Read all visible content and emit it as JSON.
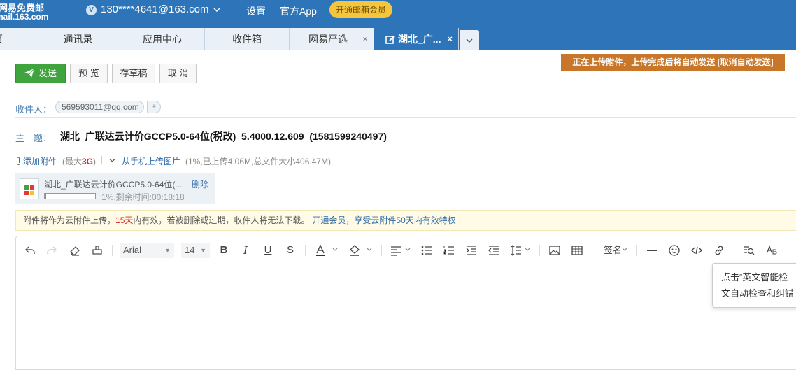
{
  "header": {
    "logo_line1": "网易免费邮",
    "logo_line2": "mail.163.com",
    "vip_badge": "V",
    "account": "130****4641@163.com",
    "links": [
      "设置",
      "官方App"
    ],
    "vip_button": "开通邮箱会员"
  },
  "tabs": [
    {
      "label": "页"
    },
    {
      "label": "通讯录"
    },
    {
      "label": "应用中心"
    },
    {
      "label": "收件箱"
    },
    {
      "label": "网易严选",
      "close": "×"
    },
    {
      "label": "湖北_广...",
      "close": "×"
    }
  ],
  "toolbar": {
    "send": "发送",
    "preview": "预 览",
    "draft": "存草稿",
    "cancel": "取 消"
  },
  "notice": {
    "text": "正在上传附件，上传完成后将自动发送 ",
    "cancel_link": "[取消自动发送]"
  },
  "recipient": {
    "label": "收件人：",
    "chip": "569593011@qq.com",
    "add": "+"
  },
  "subject": {
    "label": "主　题：",
    "value": "湖北_广联达云计价GCCP5.0-64位(税改)_5.4000.12.609_(1581599240497)"
  },
  "attachments": {
    "add_label": "添加附件",
    "max_prefix": "(最大",
    "max_value": "3G",
    "max_suffix": ")",
    "mobile_upload": "从手机上传图片",
    "summary": "(1%,已上传4.06M,总文件大小406.47M)",
    "file": {
      "name": "湖北_广联达云计价GCCP5.0-64位(...",
      "delete": "删除",
      "progress": 0.01,
      "remain": "1%,剩余时间:00:18:18"
    }
  },
  "cloud_tip": {
    "text1": "附件将作为云附件上传，",
    "days": "15天",
    "text2": "内有效，若被删除或过期，收件人将无法下载。",
    "link": "开通会员，享受云附件50天内有效特权"
  },
  "editor": {
    "font": "Arial",
    "size": "14",
    "signature": "签名"
  },
  "tooltip": {
    "line1": "点击“英文智能检",
    "line2": "文自动检查和纠错"
  }
}
